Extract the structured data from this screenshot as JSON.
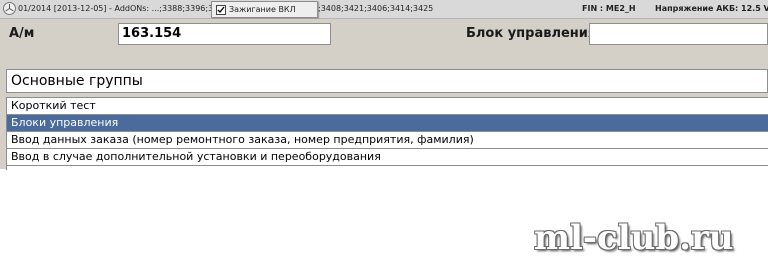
{
  "status_bar": {
    "logo_icon": "mercedes-star-icon",
    "release_text": "01/2014 [2013-12-05] - AddONs: ...;3388;3396;3405;",
    "addons_tail": ";3408;3421;3406;3414;3425",
    "ignition_tooltip": {
      "checked": true,
      "label": "Зажигание ВКЛ"
    },
    "fin_text": "FIN : ME2_H",
    "voltage_text": "Напряжение АКБ: 12.5 V"
  },
  "form": {
    "am_label": "А/м",
    "am_value": "163.154",
    "control_unit_label": "Блок управления",
    "control_unit_value": ""
  },
  "groups": {
    "title": "Основные группы",
    "items": [
      {
        "label": "Короткий тест",
        "selected": false
      },
      {
        "label": "Блоки управления",
        "selected": true
      },
      {
        "label": "Ввод данных заказа (номер ремонтного заказа, номер предприятия, фамилия)",
        "selected": false
      },
      {
        "label": "Ввод в случае дополнительной установки и переоборудования",
        "selected": false
      }
    ]
  },
  "watermark": {
    "text": "ml-club.ru"
  },
  "colors": {
    "selected_row": "#4a6b9c",
    "panel_bg": "#d4d0c8",
    "status_bg": "#d9d9d9"
  }
}
